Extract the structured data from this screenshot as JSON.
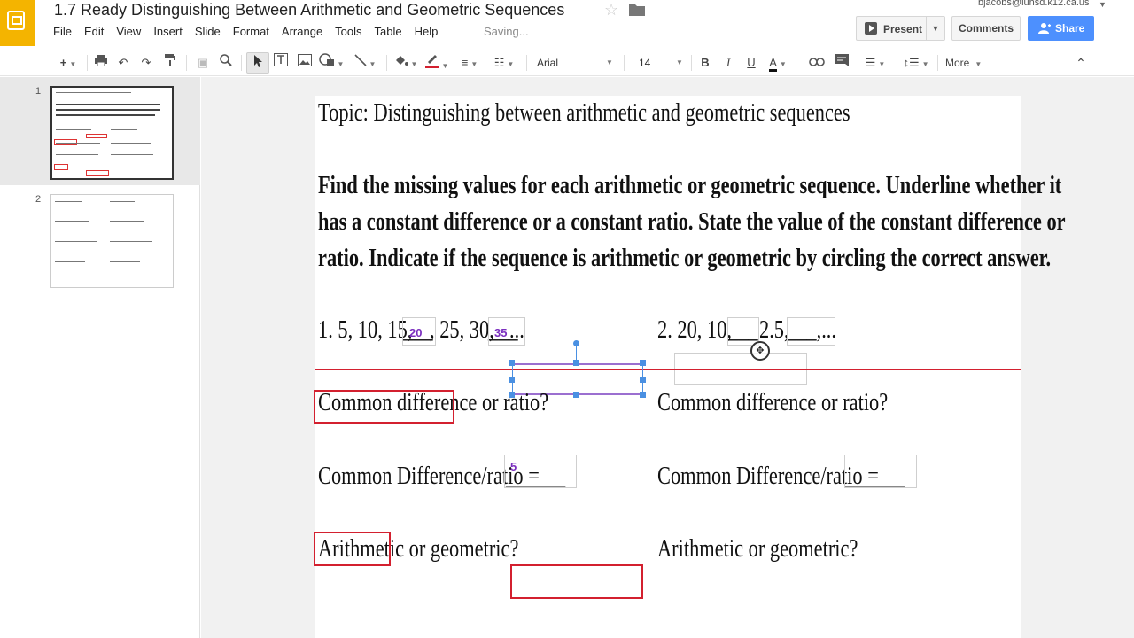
{
  "app": {
    "doc_title": "1.7 Ready Distinguishing Between Arithmetic and Geometric Sequences",
    "account": "bjacobs@luhsd.k12.ca.us",
    "saving_status": "Saving...",
    "present_label": "Present",
    "comments_label": "Comments",
    "share_label": "Share"
  },
  "menu": [
    "File",
    "Edit",
    "View",
    "Insert",
    "Slide",
    "Format",
    "Arrange",
    "Tools",
    "Table",
    "Help"
  ],
  "toolbar": {
    "font": "Arial",
    "font_size": "14",
    "bold": "B",
    "italic": "I",
    "underline": "U",
    "text_color": "A",
    "more": "More"
  },
  "filmstrip": {
    "slides": [
      {
        "number": "1"
      },
      {
        "number": "2"
      }
    ]
  },
  "slide": {
    "topic": "Topic: Distinguishing between arithmetic and geometric sequences",
    "instructions": [
      "Find the missing values for each arithmetic or geometric sequence.  Underline whether it",
      "has a constant difference or a constant ratio.  State the value of the constant difference or",
      "ratio. Indicate if the sequence is arithmetic or geometric by circling the correct answer."
    ],
    "q1": {
      "sequence_prefix": "1.  5, 10,  15,",
      "sequence_mid": ", 25, 30,",
      "sequence_suffix": "...",
      "blank1": "___",
      "blank2": "___",
      "answer1": "20",
      "answer2": "35",
      "diff_or_ratio": "Common difference or ratio?",
      "diff_value_label": "Common Difference/ratio =",
      "diff_value_blank": "______",
      "diff_value": "5",
      "arith_or_geo": "Arithmetic or geometric?"
    },
    "q2": {
      "sequence": "2.  20, 10,",
      "blank1": "___",
      "mid": "2.5,",
      "blank2": "___,...",
      "diff_or_ratio": "Common difference or ratio?",
      "diff_value_label": "Common Difference/ratio =",
      "diff_value_blank": "______",
      "arith_or_geo": "Arithmetic or geometric?"
    }
  },
  "colors": {
    "accent_blue": "#4d90fe",
    "logo_yellow": "#f4b400",
    "annotation_red": "#d3202f",
    "answer_purple": "#7b2fbf"
  }
}
